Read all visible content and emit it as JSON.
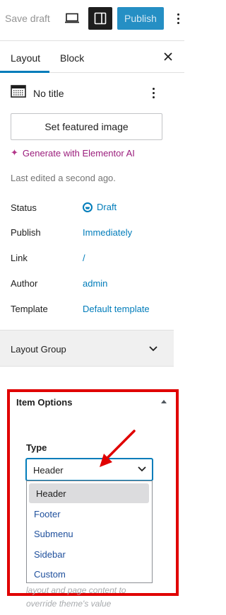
{
  "toolbar": {
    "save_draft": "Save draft",
    "publish": "Publish"
  },
  "tabs": [
    {
      "label": "Layout",
      "active": true
    },
    {
      "label": "Block",
      "active": false
    }
  ],
  "post": {
    "title": "No title",
    "featured_image_button": "Set featured image",
    "ai_link": "Generate with Elementor AI",
    "last_edited": "Last edited a second ago."
  },
  "summary": [
    {
      "label": "Status",
      "value": "Draft"
    },
    {
      "label": "Publish",
      "value": "Immediately"
    },
    {
      "label": "Link",
      "value": "/"
    },
    {
      "label": "Author",
      "value": "admin"
    },
    {
      "label": "Template",
      "value": "Default template"
    }
  ],
  "layout_group": {
    "title": "Layout Group"
  },
  "item_options": {
    "title": "Item Options",
    "type_label": "Type",
    "type_selected": "Header",
    "type_options": [
      "Header",
      "Footer",
      "Submenu",
      "Sidebar",
      "Custom"
    ],
    "help_text_line1": "layout and page content to",
    "help_text_line2": "override theme's value"
  },
  "colors": {
    "accent": "#007cba",
    "highlight_box": "#e00000",
    "ai": "#9b1d7c"
  }
}
